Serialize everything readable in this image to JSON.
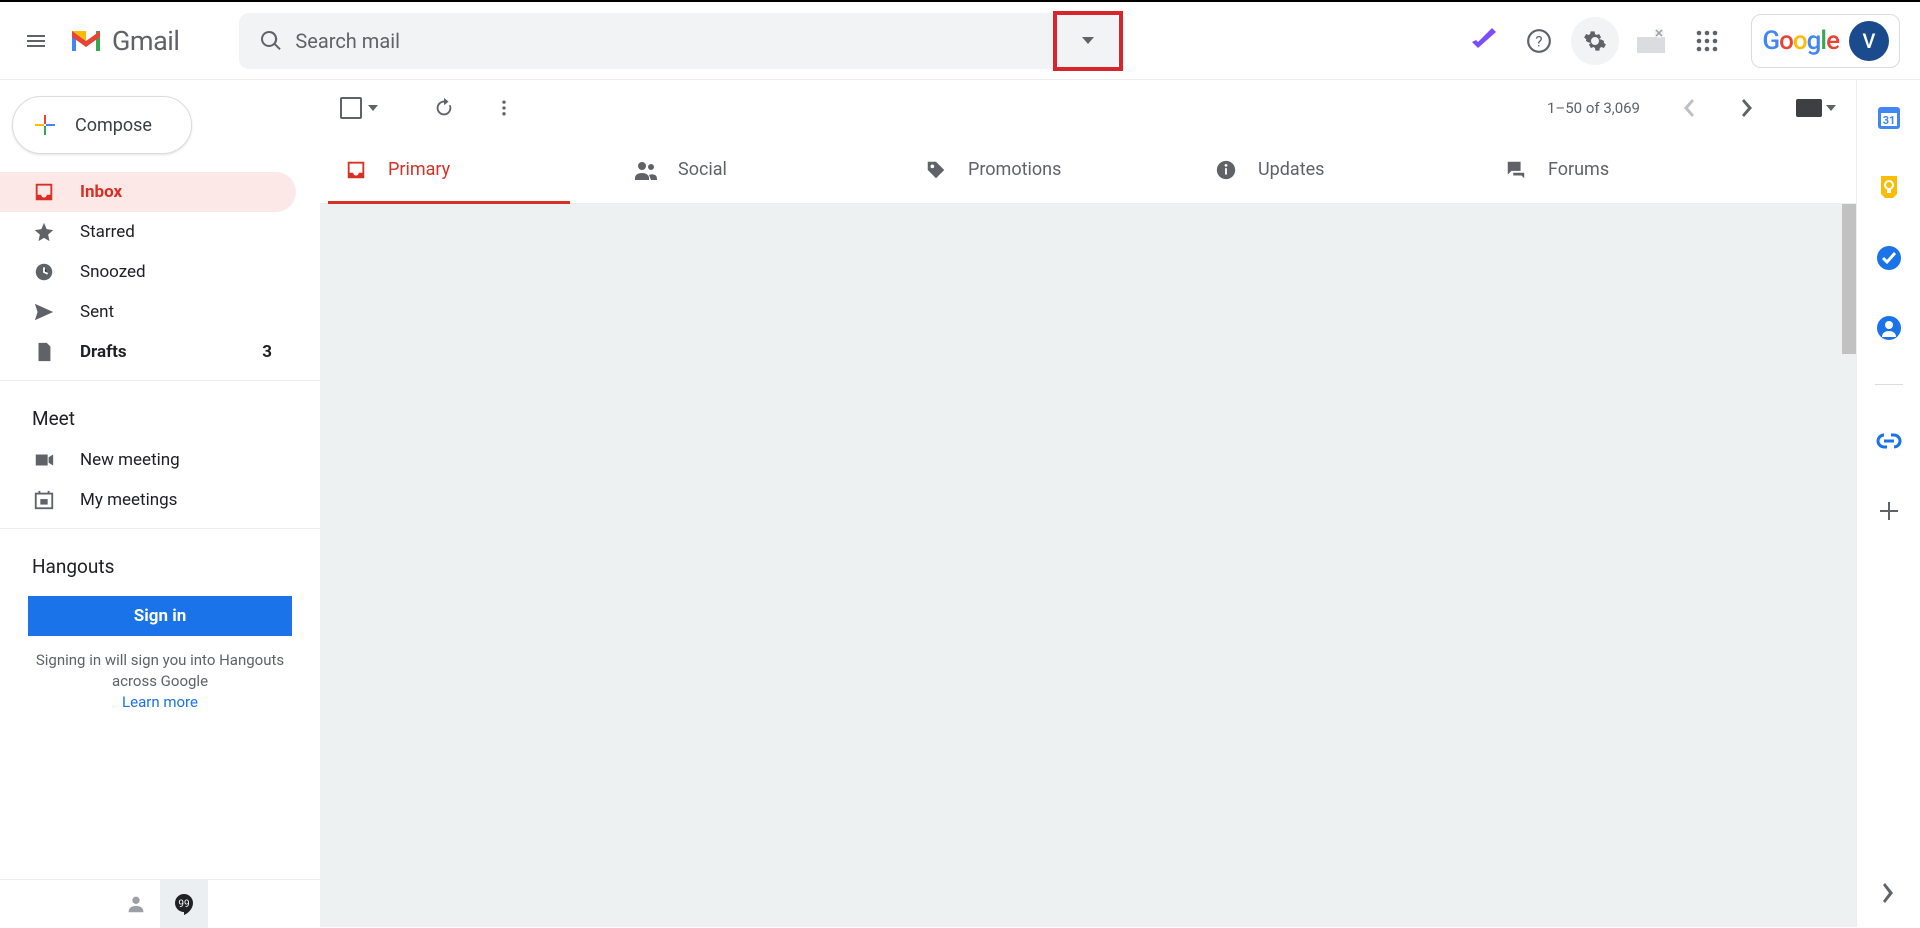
{
  "app": {
    "name": "Gmail"
  },
  "search": {
    "placeholder": "Search mail"
  },
  "compose": {
    "label": "Compose"
  },
  "sidebar": {
    "items": [
      {
        "label": "Inbox"
      },
      {
        "label": "Starred"
      },
      {
        "label": "Snoozed"
      },
      {
        "label": "Sent"
      },
      {
        "label": "Drafts",
        "count": "3"
      }
    ]
  },
  "meet": {
    "title": "Meet",
    "new_meeting": "New meeting",
    "my_meetings": "My meetings"
  },
  "hangouts": {
    "title": "Hangouts",
    "signin": "Sign in",
    "note": "Signing in will sign you into Hangouts across Google",
    "learn_more": "Learn more"
  },
  "toolbar": {
    "page_count": "1–50 of 3,069"
  },
  "tabs": [
    {
      "label": "Primary"
    },
    {
      "label": "Social"
    },
    {
      "label": "Promotions"
    },
    {
      "label": "Updates"
    },
    {
      "label": "Forums"
    }
  ],
  "google": {
    "word": "Google",
    "avatar_initial": "V"
  }
}
